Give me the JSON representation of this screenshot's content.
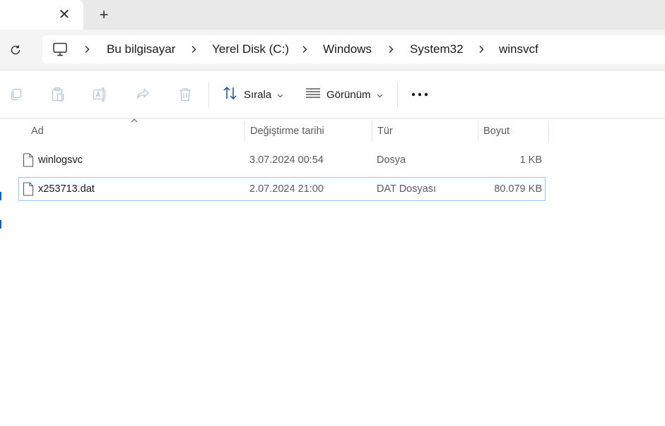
{
  "tabs": {
    "close_symbol": "✕",
    "new_tab_symbol": "+"
  },
  "address": {
    "crumbs": [
      "Bu bilgisayar",
      "Yerel Disk (C:)",
      "Windows",
      "System32",
      "winsvcf"
    ]
  },
  "commands": {
    "sort_label": "Sırala",
    "view_label": "Görünüm",
    "icons": [
      "copy-icon",
      "paste-icon",
      "rename-icon",
      "share-icon",
      "delete-icon",
      "sort-icon",
      "view-icon",
      "more-icon"
    ]
  },
  "columns": {
    "name": "Ad",
    "date": "Değiştirme tarihi",
    "type": "Tür",
    "size": "Boyut"
  },
  "files": [
    {
      "name": "winlogsvc",
      "date": "3.07.2024 00:54",
      "type": "Dosya",
      "size": "1 KB",
      "selected": false
    },
    {
      "name": "x253713.dat",
      "date": "2.07.2024 21:00",
      "type": "DAT Dosyası",
      "size": "80.079 KB",
      "selected": true
    }
  ],
  "colors": {
    "tabstrip_bg": "#e9e9e9",
    "addressrow_bg": "#f4f4f4",
    "selection_border": "#99c9ef",
    "accent": "#0067c0"
  }
}
